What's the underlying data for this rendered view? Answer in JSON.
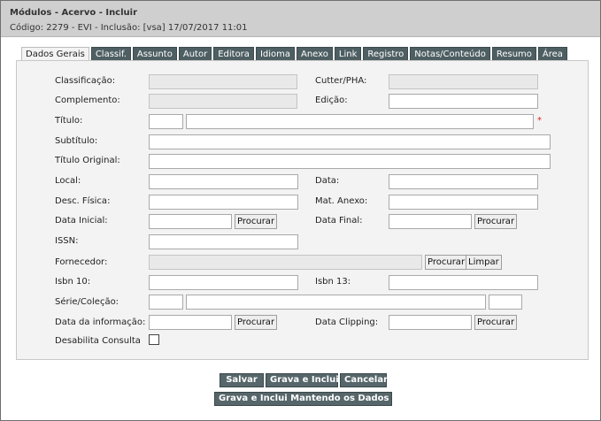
{
  "window": {
    "title": "Módulos - Acervo - Incluir",
    "subtitle": "Código: 2279 - EVI - Inclusão: [vsa] 17/07/2017 11:01"
  },
  "tabs": [
    {
      "label": "Dados Gerais",
      "active": true
    },
    {
      "label": "Classif."
    },
    {
      "label": "Assunto"
    },
    {
      "label": "Autor"
    },
    {
      "label": "Editora"
    },
    {
      "label": "Idioma"
    },
    {
      "label": "Anexo"
    },
    {
      "label": "Link"
    },
    {
      "label": "Registro"
    },
    {
      "label": "Notas/Conteúdo"
    },
    {
      "label": "Resumo"
    },
    {
      "label": "Área"
    }
  ],
  "form": {
    "classificacao": "Classificação:",
    "cutter": "Cutter/PHA:",
    "complemento": "Complemento:",
    "edicao": "Edição:",
    "titulo": "Título:",
    "subtitulo": "Subtítulo:",
    "titulo_original": "Título Original:",
    "local": "Local:",
    "data": "Data:",
    "desc_fisica": "Desc. Física:",
    "mat_anexo": "Mat. Anexo:",
    "data_inicial": "Data Inicial:",
    "data_final": "Data Final:",
    "issn": "ISSN:",
    "fornecedor": "Fornecedor:",
    "isbn10": "Isbn 10:",
    "isbn13": "Isbn 13:",
    "serie_colecao": "Série/Coleção:",
    "data_informacao": "Data da informação:",
    "data_clipping": "Data Clipping:",
    "desabilita_consulta": "Desabilita Consulta",
    "required_mark": "*"
  },
  "buttons": {
    "procurar": "Procurar",
    "limpar": "Limpar",
    "salvar": "Salvar",
    "grava_inclui": "Grava e Inclui",
    "cancelar": "Cancelar",
    "grava_inclui_mantendo": "Grava e Inclui Mantendo os Dados"
  },
  "colors": {
    "tab_bg": "#4e5f63",
    "action_button_bg": "#56666a",
    "required": "#dd2222"
  }
}
